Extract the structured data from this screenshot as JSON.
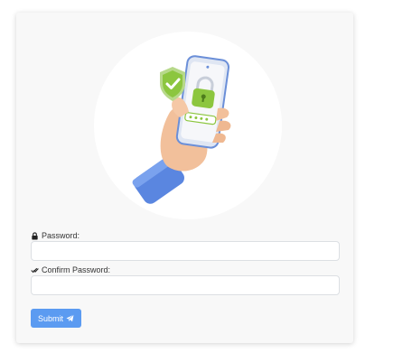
{
  "form": {
    "password_label": "Password:",
    "password_value": "",
    "password_placeholder": "",
    "confirm_label": "Confirm Password:",
    "confirm_value": "",
    "confirm_placeholder": "",
    "submit_label": "Submit"
  },
  "icons": {
    "password": "lock-icon",
    "confirm": "double-check-icon",
    "submit": "paper-plane-icon",
    "illustration": "hand-holding-phone-with-shield-and-lock"
  },
  "colors": {
    "accent": "#5b9bf1",
    "shield_green": "#8cc63f",
    "sleeve_blue": "#5a86e0"
  }
}
